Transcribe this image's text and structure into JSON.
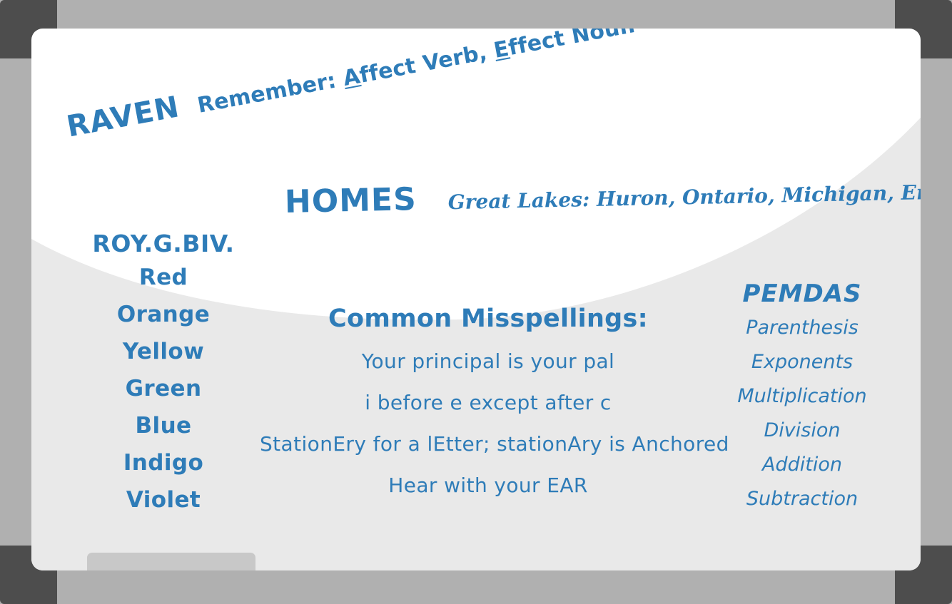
{
  "scene": {
    "kind": "classroom-whiteboard",
    "frame_color": "#b0b0b0",
    "frame_corner_color": "#4d4d4d",
    "board_color": "#ffffff",
    "board_shade_color": "#e9e9e9",
    "ink_color": "#2e7cb8"
  },
  "raven": {
    "acronym": "RAVEN",
    "note_prefix": "Remember: ",
    "note_a": "A",
    "note_mid": "ffect Verb, ",
    "note_e": "E",
    "note_end": "ffect Noun",
    "note_full": "Remember: Affect Verb, Effect Noun"
  },
  "homes": {
    "acronym": "HOMES",
    "note": "Great Lakes: Huron, Ontario, Michigan, Erie, and Superior"
  },
  "roygbiv": {
    "title": "ROY.G.BIV.",
    "items": [
      "Red",
      "Orange",
      "Yellow",
      "Green",
      "Blue",
      "Indigo",
      "Violet"
    ]
  },
  "misspellings": {
    "title": "Common Misspellings:",
    "items": [
      "Your principal is your pal",
      "i before e except after c",
      "StationEry for a lEtter; stationAry is Anchored",
      "Hear with your EAR"
    ]
  },
  "pemdas": {
    "title": "PEMDAS",
    "items": [
      "Parenthesis",
      "Exponents",
      "Multiplication",
      "Division",
      "Addition",
      "Subtraction"
    ]
  },
  "tray": {
    "label": "marker-tray"
  }
}
